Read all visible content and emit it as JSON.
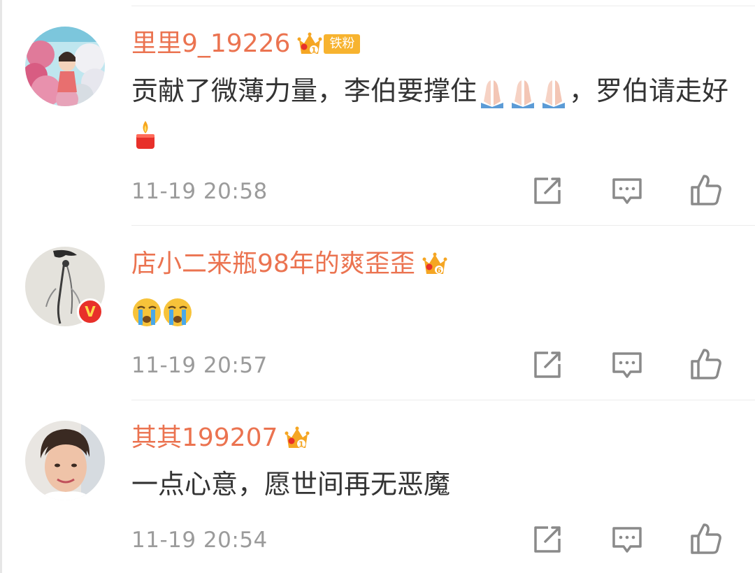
{
  "comments": [
    {
      "username": "里里9_19226",
      "crown_level": "1",
      "fan_tag": "铁粉",
      "text_a": "贡献了微薄力量，李伯要撑住",
      "text_b": "，罗伯请走好",
      "emojis_a": [
        "folded-hands-icon",
        "folded-hands-icon",
        "folded-hands-icon"
      ],
      "emojis_b": [
        "candle-icon"
      ],
      "time": "11-19 20:58",
      "verified": false
    },
    {
      "username": "店小二来瓶98年的爽歪歪",
      "crown_level": "6",
      "text_a": "",
      "emojis_a": [
        "crying-face-icon",
        "crying-face-icon"
      ],
      "time": "11-19 20:57",
      "verified": true,
      "verified_mark": "V"
    },
    {
      "username": "其其199207",
      "crown_level": "1",
      "text_a": "一点心意，愿世间再无恶魔",
      "time": "11-19 20:54",
      "verified": false
    }
  ],
  "actions": [
    "share-icon",
    "comment-icon",
    "like-icon"
  ],
  "colors": {
    "username": "#eb7350",
    "text": "#333333",
    "time": "#9b9b9b",
    "crown": "#f5a623",
    "fan_tag": "#f7b32f",
    "verified": "#e8302a",
    "icon": "#8a8a8a",
    "divider": "#ececec"
  }
}
